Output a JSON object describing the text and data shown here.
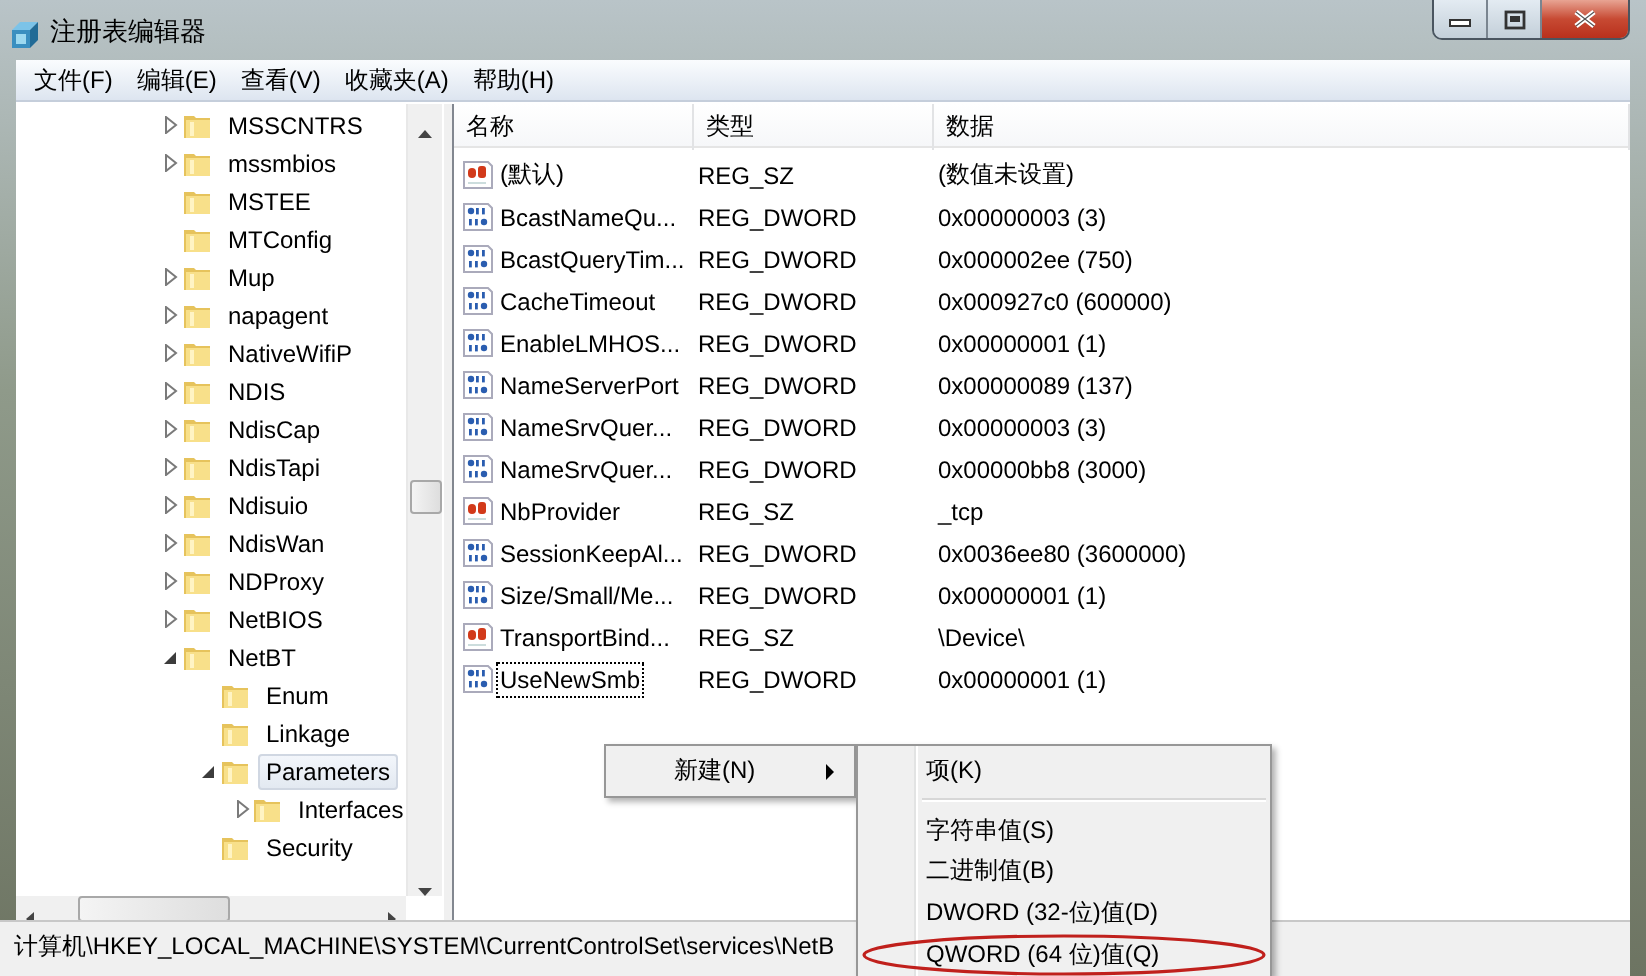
{
  "window": {
    "title": "注册表编辑器"
  },
  "menu": [
    "文件(F)",
    "编辑(E)",
    "查看(V)",
    "收藏夹(A)",
    "帮助(H)"
  ],
  "tree": {
    "items": [
      {
        "label": "MSSCNTRS",
        "expandable": true,
        "expanded": false,
        "selected": false
      },
      {
        "label": "mssmbios",
        "expandable": true,
        "expanded": false,
        "selected": false
      },
      {
        "label": "MSTEE",
        "expandable": false,
        "selected": false
      },
      {
        "label": "MTConfig",
        "expandable": false,
        "selected": false
      },
      {
        "label": "Mup",
        "expandable": true,
        "expanded": false,
        "selected": false
      },
      {
        "label": "napagent",
        "expandable": true,
        "expanded": false,
        "selected": false
      },
      {
        "label": "NativeWifiP",
        "expandable": true,
        "expanded": false,
        "selected": false
      },
      {
        "label": "NDIS",
        "expandable": true,
        "expanded": false,
        "selected": false
      },
      {
        "label": "NdisCap",
        "expandable": true,
        "expanded": false,
        "selected": false
      },
      {
        "label": "NdisTapi",
        "expandable": true,
        "expanded": false,
        "selected": false
      },
      {
        "label": "Ndisuio",
        "expandable": true,
        "expanded": false,
        "selected": false
      },
      {
        "label": "NdisWan",
        "expandable": true,
        "expanded": false,
        "selected": false
      },
      {
        "label": "NDProxy",
        "expandable": true,
        "expanded": false,
        "selected": false
      },
      {
        "label": "NetBIOS",
        "expandable": true,
        "expanded": false,
        "selected": false
      },
      {
        "label": "NetBT",
        "expandable": true,
        "expanded": true,
        "selected": false,
        "children": [
          {
            "label": "Enum",
            "expandable": false,
            "selected": false
          },
          {
            "label": "Linkage",
            "expandable": false,
            "selected": false
          },
          {
            "label": "Parameters",
            "expandable": true,
            "expanded": true,
            "selected": true,
            "children": [
              {
                "label": "Interfaces",
                "expandable": true,
                "expanded": false,
                "selected": false
              }
            ]
          },
          {
            "label": "Security",
            "expandable": false,
            "selected": false
          }
        ]
      }
    ]
  },
  "list": {
    "columns": [
      "名称",
      "类型",
      "数据"
    ],
    "rows": [
      {
        "kind": "string",
        "name": "(默认)",
        "type": "REG_SZ",
        "data": "(数值未设置)",
        "focused": false
      },
      {
        "kind": "binary",
        "name": "BcastNameQu...",
        "type": "REG_DWORD",
        "data": "0x00000003 (3)",
        "focused": false
      },
      {
        "kind": "binary",
        "name": "BcastQueryTim...",
        "type": "REG_DWORD",
        "data": "0x000002ee (750)",
        "focused": false
      },
      {
        "kind": "binary",
        "name": "CacheTimeout",
        "type": "REG_DWORD",
        "data": "0x000927c0 (600000)",
        "focused": false
      },
      {
        "kind": "binary",
        "name": "EnableLMHOS...",
        "type": "REG_DWORD",
        "data": "0x00000001 (1)",
        "focused": false
      },
      {
        "kind": "binary",
        "name": "NameServerPort",
        "type": "REG_DWORD",
        "data": "0x00000089 (137)",
        "focused": false
      },
      {
        "kind": "binary",
        "name": "NameSrvQuer...",
        "type": "REG_DWORD",
        "data": "0x00000003 (3)",
        "focused": false
      },
      {
        "kind": "binary",
        "name": "NameSrvQuer...",
        "type": "REG_DWORD",
        "data": "0x00000bb8 (3000)",
        "focused": false
      },
      {
        "kind": "string",
        "name": "NbProvider",
        "type": "REG_SZ",
        "data": "_tcp",
        "focused": false
      },
      {
        "kind": "binary",
        "name": "SessionKeepAl...",
        "type": "REG_DWORD",
        "data": "0x0036ee80 (3600000)",
        "focused": false
      },
      {
        "kind": "binary",
        "name": "Size/Small/Me...",
        "type": "REG_DWORD",
        "data": "0x00000001 (1)",
        "focused": false
      },
      {
        "kind": "string",
        "name": "TransportBind...",
        "type": "REG_SZ",
        "data": "\\Device\\",
        "focused": false
      },
      {
        "kind": "binary",
        "name": "UseNewSmb",
        "type": "REG_DWORD",
        "data": "0x00000001 (1)",
        "focused": true
      }
    ]
  },
  "status_bar": {
    "path": "计算机\\HKEY_LOCAL_MACHINE\\SYSTEM\\CurrentControlSet\\services\\NetB"
  },
  "context_menu": {
    "items": [
      {
        "label": "新建(N)",
        "has_submenu": true
      }
    ]
  },
  "submenu": {
    "items": [
      {
        "kind": "item",
        "label": "项(K)",
        "circled": false
      },
      {
        "kind": "separator"
      },
      {
        "kind": "item",
        "label": "字符串值(S)",
        "circled": false
      },
      {
        "kind": "item",
        "label": "二进制值(B)",
        "circled": false
      },
      {
        "kind": "item",
        "label": "DWORD (32-位)值(D)",
        "circled": false
      },
      {
        "kind": "item",
        "label": "QWORD (64 位)值(Q)",
        "circled": true
      }
    ]
  }
}
